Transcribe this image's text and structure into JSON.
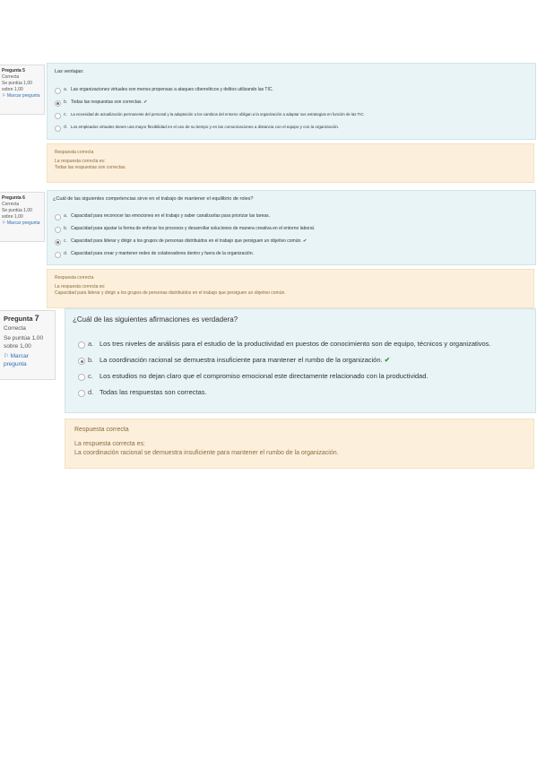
{
  "q5": {
    "number_label": "Pregunta",
    "number": "5",
    "status": "Correcta",
    "grade": "Se puntúa 1,00 sobre 1,00",
    "flag": "Marcar pregunta",
    "question": "Las ventajas:",
    "answers": [
      {
        "letter": "a.",
        "text": "Las organizaciones virtuales son menos propensas a ataques cibernéticos y delitos utilizando las TIC.",
        "correct": false,
        "selected": false
      },
      {
        "letter": "b.",
        "text": "Todas las respuestas son correctas.",
        "correct": true,
        "selected": true
      },
      {
        "letter": "c.",
        "text": "La necesidad de actualización permanente del personal y la adaptación a los cambios del entorno obligan a la organización a adaptar sus estrategias en función de las TIC.",
        "correct": false,
        "selected": false
      },
      {
        "letter": "d.",
        "text": "Los empleados virtuales tienen una mayor flexibilidad en el uso de su tiempo y en las comunicaciones a distancia con el equipo y con la organización.",
        "correct": false,
        "selected": false
      }
    ],
    "feedback_title": "Respuesta correcta",
    "feedback_intro": "La respuesta correcta es:",
    "feedback_answer": "Todas las respuestas son correctas."
  },
  "q6": {
    "number_label": "Pregunta",
    "number": "6",
    "status": "Correcta",
    "grade": "Se puntúa 1,00 sobre 1,00",
    "flag": "Marcar pregunta",
    "question": "¿Cuál de las siguientes competencias sirve en el trabajo de mantener el equilibrio de roles?",
    "answers": [
      {
        "letter": "a.",
        "text": "Capacidad para reconocer las emociones en el trabajo y saber canalizarlas para priorizar las tareas.",
        "correct": false,
        "selected": false
      },
      {
        "letter": "b.",
        "text": "Capacidad para ajustar la forma de enfocar los procesos y desarrollar soluciones de manera creativa en el entorno laboral.",
        "correct": false,
        "selected": false
      },
      {
        "letter": "c.",
        "text": "Capacidad para liderar y dirigir a los grupos de personas distribuidos en el trabajo que persiguen un objetivo común.",
        "correct": true,
        "selected": true
      },
      {
        "letter": "d.",
        "text": "Capacidad para crear y mantener redes de colaboradores dentro y fuera de la organización.",
        "correct": false,
        "selected": false
      }
    ],
    "feedback_title": "Respuesta correcta",
    "feedback_intro": "La respuesta correcta es:",
    "feedback_answer": "Capacidad para liderar y dirigir a los grupos de personas distribuidos en el trabajo que persiguen un objetivo común."
  },
  "q7": {
    "number_label": "Pregunta",
    "number": "7",
    "status": "Correcta",
    "grade": "Se puntúa 1,00 sobre 1,00",
    "flag": "Marcar pregunta",
    "question": "¿Cuál de las siguientes afirmaciones es verdadera?",
    "answers": [
      {
        "letter": "a.",
        "text": "Los tres niveles de análisis para el estudio de la productividad en puestos de conocimiento son de equipo, técnicos y organizativos.",
        "correct": false,
        "selected": false
      },
      {
        "letter": "b.",
        "text": "La coordinación racional se demuestra insuficiente para mantener el rumbo de la organización.",
        "correct": true,
        "selected": true
      },
      {
        "letter": "c.",
        "text": "Los estudios no dejan claro que el compromiso emocional este directamente relacionado con la productividad.",
        "correct": false,
        "selected": false
      },
      {
        "letter": "d.",
        "text": "Todas las respuestas son correctas.",
        "correct": false,
        "selected": false
      }
    ],
    "feedback_title": "Respuesta correcta",
    "feedback_intro": "La respuesta correcta es:",
    "feedback_answer": "La coordinación racional se demuestra insuficiente para mantener el rumbo de la organización."
  },
  "colors": {
    "content_bg": "#e8f4f6",
    "feedback_bg": "#fcefdc",
    "correct_check": "#3b8a3b",
    "link": "#2f6fb0"
  },
  "icons": {
    "correct": "check-icon",
    "flag": "flag-icon"
  }
}
